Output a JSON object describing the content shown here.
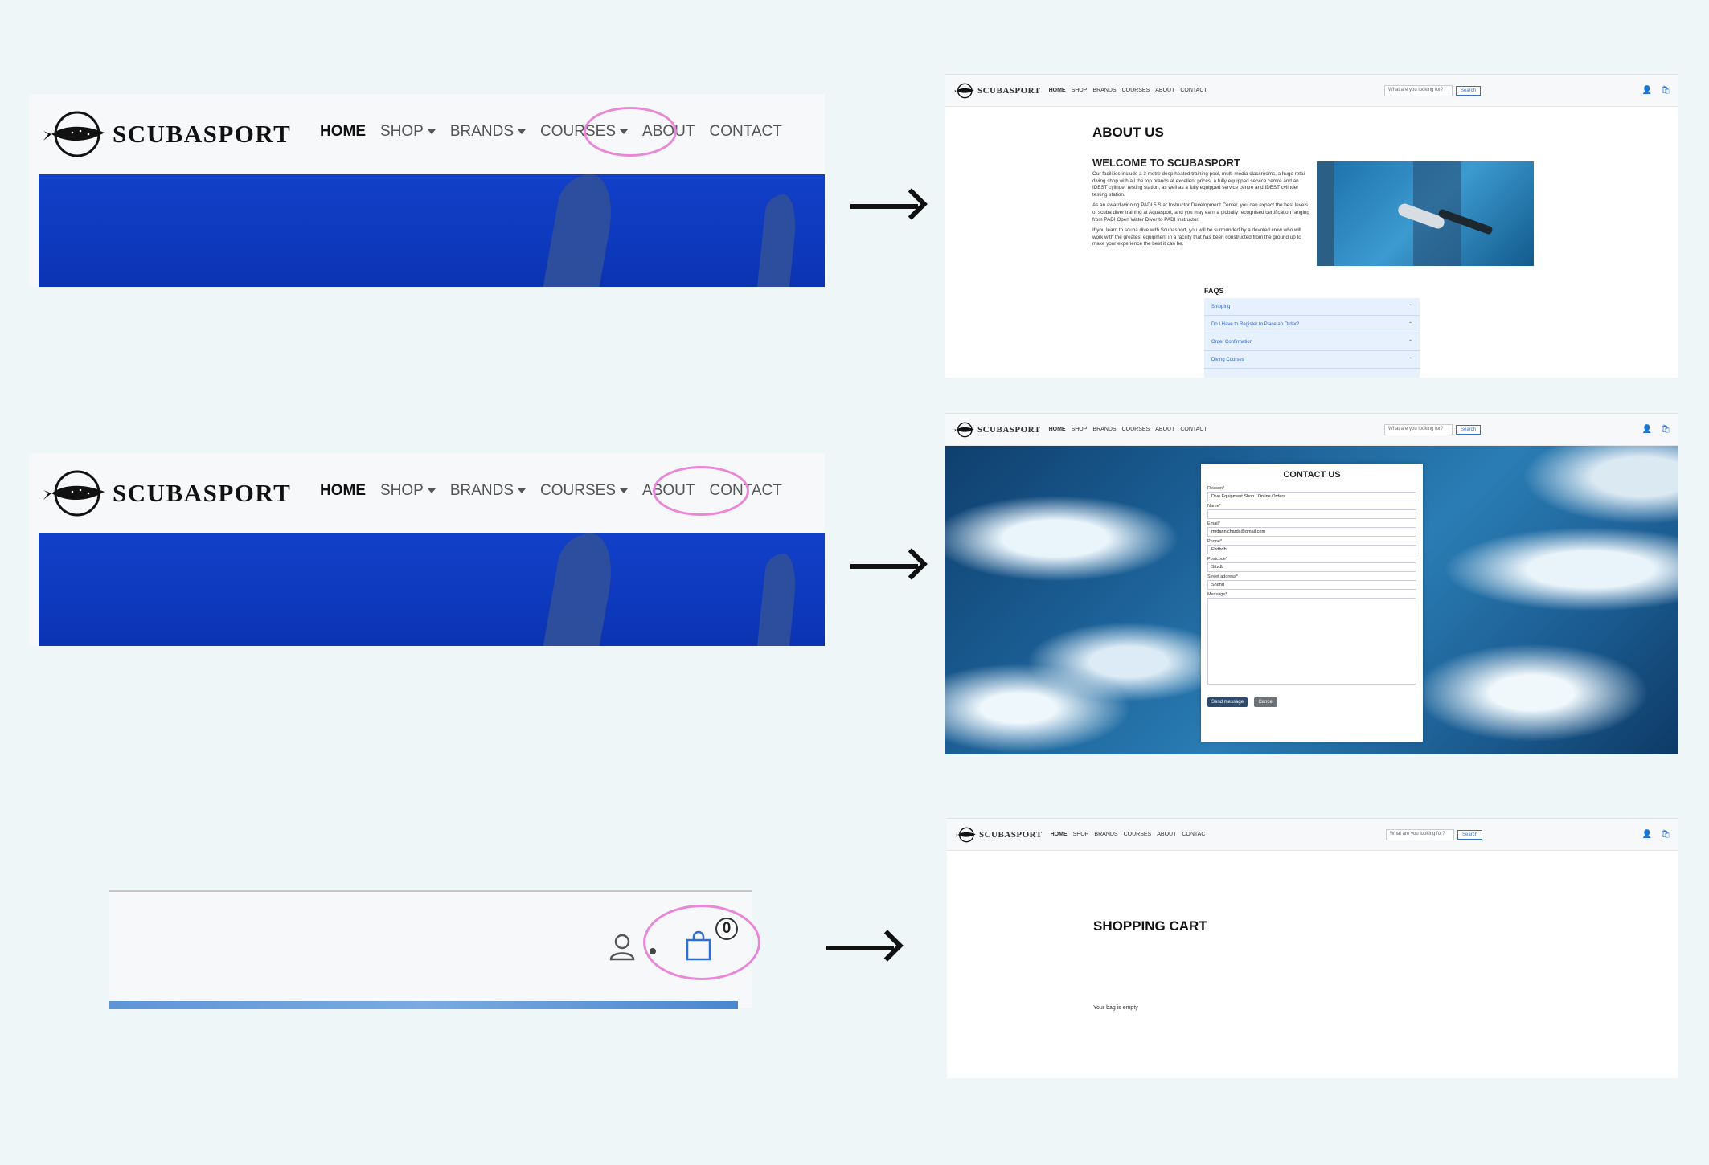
{
  "brand": "SCUBASPORT",
  "nav": {
    "home": "HOME",
    "shop": "SHOP",
    "brands": "BRANDS",
    "courses": "COURSES",
    "about": "ABOUT",
    "contact": "CONTACT"
  },
  "search": {
    "placeholder": "What are you looking for?",
    "button": "Search"
  },
  "cart_count": "0",
  "about_page": {
    "title": "ABOUT US",
    "welcome": "WELCOME TO SCUBASPORT",
    "p1": "Our facilities include a 3 metre deep heated training pool, multi-media classrooms, a huge retail diving shop with all the top brands at excellent prices, a fully equipped service centre and an IDEST cylinder testing station, as well as a fully equipped service centre and IDEST cylinder testing station.",
    "p2": "As an award-winning PADI 5 Star Instructor Development Center, you can expect the best levels of scuba diver training at Aquasport, and you may earn a globally recognised certification ranging from PADI Open Water Diver to PADI Instructor.",
    "p3": "If you learn to scuba dive with Scubasport, you will be surrounded by a devoted crew who will work with the greatest equipment in a facility that has been constructed from the ground up to make your experience the best it can be.",
    "faqs_title": "FAQS",
    "faqs": [
      "Shipping",
      "Do I Have to Register to Place an Order?",
      "Order Confirmation",
      "Diving Courses"
    ]
  },
  "contact_page": {
    "title": "CONTACT US",
    "fields": [
      {
        "label": "Reason*",
        "value": "Dive Equipment Shop / Online Orders"
      },
      {
        "label": "Name*",
        "value": ""
      },
      {
        "label": "Email*",
        "value": "mrdannichards@gmail.com"
      },
      {
        "label": "Phone*",
        "value": "Fhdhdh"
      },
      {
        "label": "Postcode*",
        "value": "Sitvdb"
      },
      {
        "label": "Street address*",
        "value": "Shdhd"
      }
    ],
    "message_label": "Message*",
    "send": "Send message",
    "cancel": "Cancel"
  },
  "cart_page": {
    "title": "SHOPPING CART",
    "empty": "Your bag is empty"
  },
  "colors": {
    "highlight": "#e986d8",
    "accent": "#2c6fd6",
    "banner": "#0f3cc2",
    "background": "#eff6f8"
  }
}
